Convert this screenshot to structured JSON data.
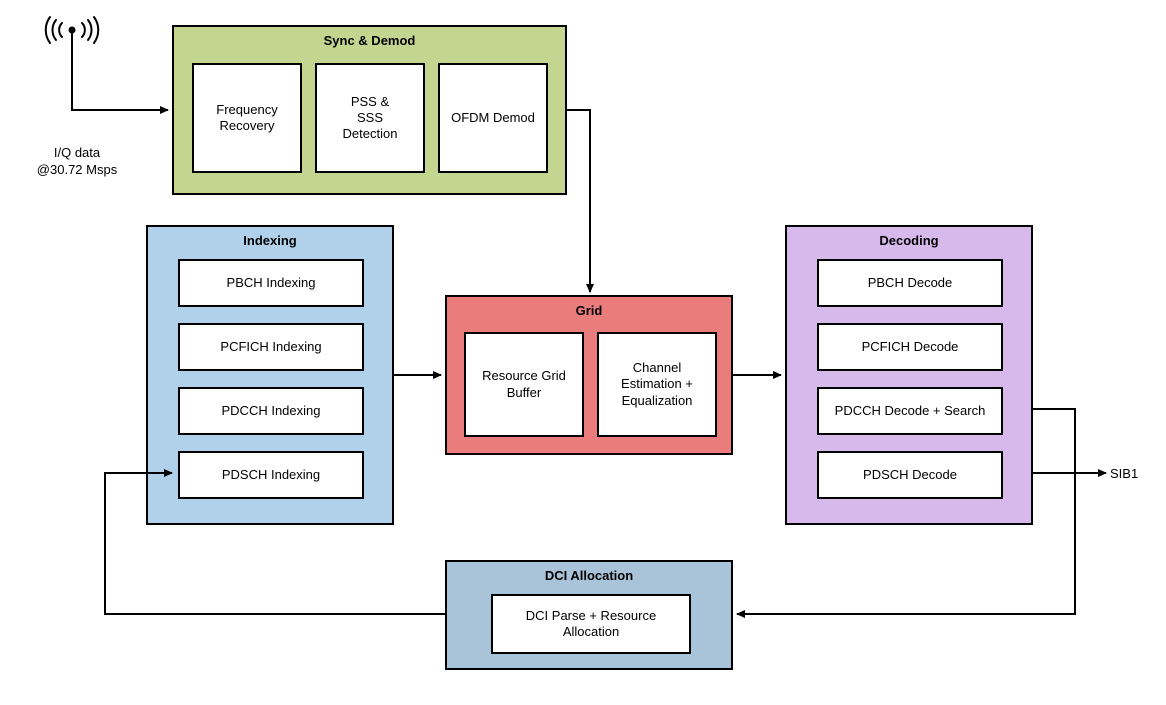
{
  "antenna": {
    "label": "I/Q data\n@30.72 Msps"
  },
  "sync_demod": {
    "title": "Sync & Demod",
    "boxes": [
      "Frequency Recovery",
      "PSS &\nSSS\nDetection",
      "OFDM Demod"
    ]
  },
  "indexing": {
    "title": "Indexing",
    "boxes": [
      "PBCH Indexing",
      "PCFICH Indexing",
      "PDCCH Indexing",
      "PDSCH Indexing"
    ]
  },
  "grid": {
    "title": "Grid",
    "boxes": [
      "Resource Grid Buffer",
      "Channel Estimation + Equalization"
    ]
  },
  "decoding": {
    "title": "Decoding",
    "boxes": [
      "PBCH Decode",
      "PCFICH Decode",
      "PDCCH Decode + Search",
      "PDSCH Decode"
    ]
  },
  "dci": {
    "title": "DCI Allocation",
    "boxes": [
      "DCI Parse + Resource Allocation"
    ]
  },
  "output": {
    "label": "SIB1"
  },
  "colors": {
    "sync": "#c3d58e",
    "indexing": "#b1d0e9",
    "grid": "#ea7c7c",
    "decoding": "#d7b9ec",
    "dci": "#a9c3d9"
  }
}
